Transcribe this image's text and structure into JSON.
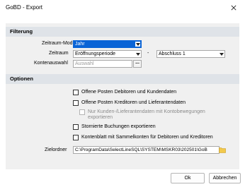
{
  "window": {
    "title": "GoBD - Export"
  },
  "filterung": {
    "heading": "Filterung",
    "zeitraum_modus": {
      "label": "Zeitraum-Modus",
      "value": "Jahr"
    },
    "zeitraum": {
      "label": "Zeitraum",
      "from": "Eröffnungsperiode",
      "separator": "-",
      "to": "Abschluss 1"
    },
    "kontenauswahl": {
      "label": "Kontenauswahl",
      "placeholder": "Auswahl",
      "button": "..."
    }
  },
  "optionen": {
    "heading": "Optionen",
    "checkboxes": [
      {
        "label": "Offene Posten Debitoren und Kundendaten",
        "checked": false,
        "enabled": true
      },
      {
        "label": "Offene Posten Kreditoren und Lieferantendaten",
        "checked": false,
        "enabled": true
      },
      {
        "label": "Nur Kunden-/Lieferantendaten mit Kontobewegungen",
        "label2": "exportieren",
        "checked": false,
        "enabled": false
      },
      {
        "label": "Stornierte Buchungen exportieren",
        "checked": false,
        "enabled": true
      },
      {
        "label": "Kontenblatt mit Sammelkonten für Debitoren und Kreditoren",
        "checked": false,
        "enabled": true
      }
    ],
    "zielordner": {
      "label": "Zielordner",
      "value": "C:\\ProgramData\\SelectLineSQL\\SYSTEM\\MSKR03\\202501\\GoB"
    }
  },
  "buttons": {
    "ok": "Ok",
    "cancel": "Abbrechen"
  },
  "colors": {
    "selection": "#0a64d6",
    "section_bg": "#dfe3e8",
    "body_bg": "#f0f0f0",
    "folder": "#f2c94c"
  }
}
